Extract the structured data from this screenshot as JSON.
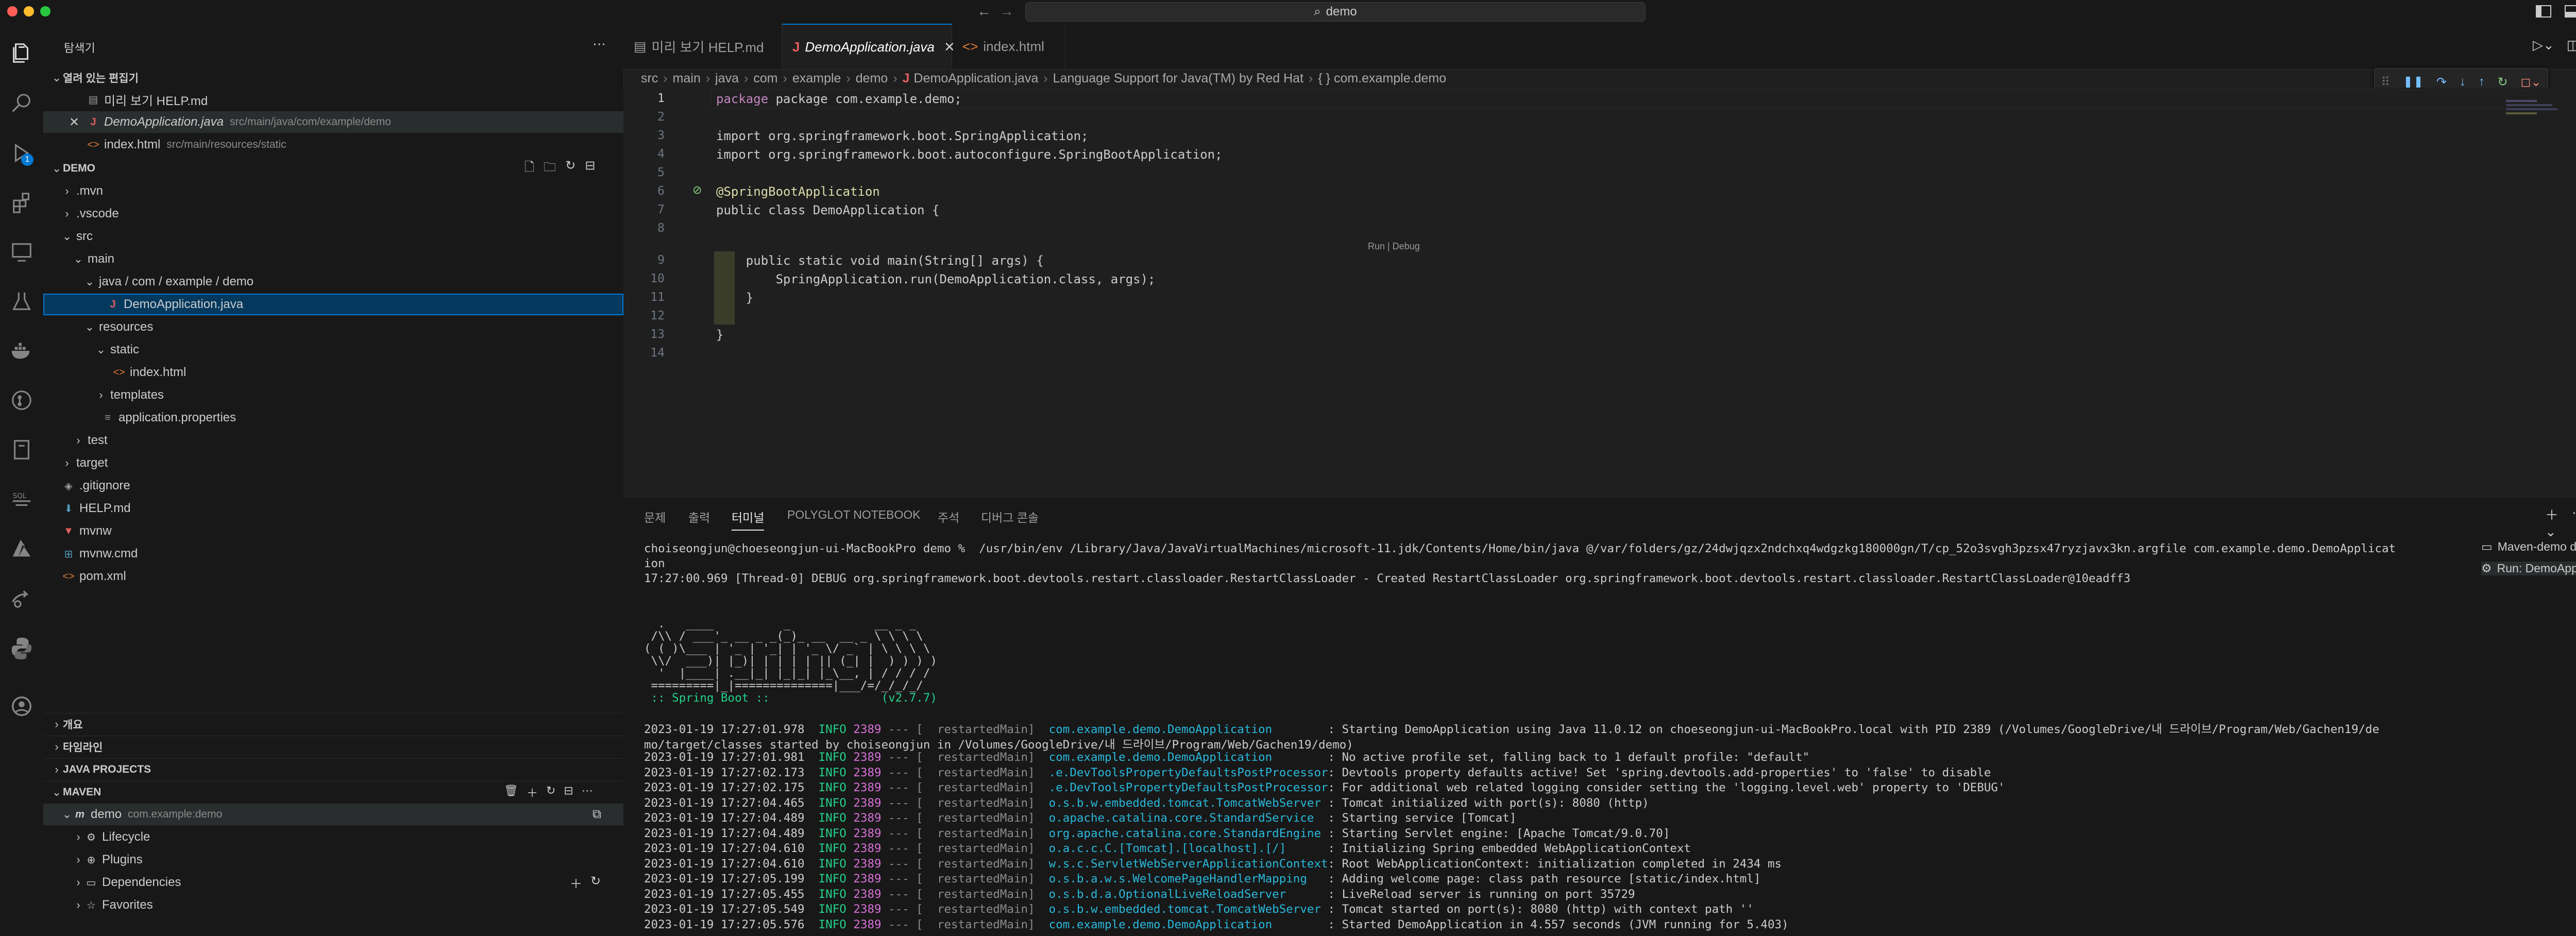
{
  "titlebar": {
    "search_text": "demo"
  },
  "activity": {
    "badge": "1"
  },
  "sidebar": {
    "header": "탐색기",
    "open_editors": {
      "title": "열려 있는 편집기",
      "items": [
        {
          "name": "미리 보기 HELP.md",
          "path": ""
        },
        {
          "name": "DemoApplication.java",
          "path": "src/main/java/com/example/demo"
        },
        {
          "name": "index.html",
          "path": "src/main/resources/static"
        }
      ]
    },
    "project": {
      "title": "DEMO",
      "tree": [
        ".mvn",
        ".vscode",
        "src",
        "main",
        "java / com / example / demo",
        "DemoApplication.java",
        "resources",
        "static",
        "index.html",
        "templates",
        "application.properties",
        "test",
        "target",
        ".gitignore",
        "HELP.md",
        "mvnw",
        "mvnw.cmd",
        "pom.xml"
      ]
    },
    "sections": [
      "개요",
      "타임라인",
      "JAVA PROJECTS",
      "MAVEN"
    ],
    "maven": {
      "project": "demo",
      "artifact": "com.example:demo",
      "children": [
        "Lifecycle",
        "Plugins",
        "Dependencies",
        "Favorites"
      ]
    }
  },
  "tabs": [
    "미리 보기 HELP.md",
    "DemoApplication.java",
    "index.html"
  ],
  "breadcrumb": [
    "src",
    "main",
    "java",
    "com",
    "example",
    "demo",
    "DemoApplication.java",
    "Language Support for Java(TM) by Red Hat",
    "{ } com.example.demo"
  ],
  "editor": {
    "codelens": "Run | Debug",
    "lines": [
      "1",
      "2",
      "3",
      "4",
      "5",
      "6",
      "7",
      "8",
      "9",
      "10",
      "11",
      "12",
      "13",
      "14"
    ],
    "code": {
      "l1": "package com.example.demo;",
      "l3": "import org.springframework.boot.SpringApplication;",
      "l4": "import org.springframework.boot.autoconfigure.SpringBootApplication;",
      "l6": "@SpringBootApplication",
      "l7": "public class DemoApplication {",
      "l9": "    public static void main(String[] args) {",
      "l10": "        SpringApplication.run(DemoApplication.class, args);",
      "l11": "    }",
      "l13": "}"
    }
  },
  "panel": {
    "tabs": [
      "문제",
      "출력",
      "터미널",
      "POLYGLOT NOTEBOOK",
      "주석",
      "디버그 콘솔"
    ],
    "terminals": [
      "Maven-demo d...",
      "Run: DemoAppli..."
    ],
    "terminal_lines": [
      "choiseongjun@choeseongjun-ui-MacBookPro demo %  /usr/bin/env /Library/Java/JavaVirtualMachines/microsoft-11.jdk/Contents/Home/bin/java @/var/folders/gz/24dwjqzx2ndchxq4wdgzkg180000gn/T/cp_52o3svgh3pzsx47ryzjavx3kn.argfile com.example.demo.DemoApplicat",
      "ion",
      "17:27:00.969 [Thread-0] DEBUG org.springframework.boot.devtools.restart.classloader.RestartClassLoader - Created RestartClassLoader org.springframework.boot.devtools.restart.classloader.RestartClassLoader@10eadff3"
    ],
    "banner": [
      "  .   ____          _            __ _ _",
      " /\\\\ / ___'_ __ _ _(_)_ __  __ _ \\ \\ \\ \\",
      "( ( )\\___ | '_ | '_| | '_ \\/ _` | \\ \\ \\ \\",
      " \\\\/  ___)| |_)| | | | | || (_| |  ) ) ) )",
      "  '  |____| .__|_| |_|_| |_\\__, | / / / /",
      " =========|_|==============|___/=/_/_/_/",
      " :: Spring Boot ::                (v2.7.7)"
    ],
    "logs": [
      [
        "2023-01-19 17:27:01.978",
        "INFO",
        "2389",
        "--- [  restartedMain] ",
        "com.example.demo.DemoApplication        ",
        ": Starting DemoApplication using Java 11.0.12 on choeseongjun-ui-MacBookPro.local with PID 2389 (/Volumes/GoogleDrive/내 드라이브/Program/Web/Gachen19/de"
      ],
      [
        "mo/target/classes started by choiseongjun in /Volumes/GoogleDrive/내 드라이브/Program/Web/Gachen19/demo)",
        "",
        "",
        "",
        "",
        ""
      ],
      [
        "2023-01-19 17:27:01.981",
        "INFO",
        "2389",
        "--- [  restartedMain] ",
        "com.example.demo.DemoApplication        ",
        ": No active profile set, falling back to 1 default profile: \"default\""
      ],
      [
        "2023-01-19 17:27:02.173",
        "INFO",
        "2389",
        "--- [  restartedMain] ",
        ".e.DevToolsPropertyDefaultsPostProcessor",
        ": Devtools property defaults active! Set 'spring.devtools.add-properties' to 'false' to disable"
      ],
      [
        "2023-01-19 17:27:02.175",
        "INFO",
        "2389",
        "--- [  restartedMain] ",
        ".e.DevToolsPropertyDefaultsPostProcessor",
        ": For additional web related logging consider setting the 'logging.level.web' property to 'DEBUG'"
      ],
      [
        "2023-01-19 17:27:04.465",
        "INFO",
        "2389",
        "--- [  restartedMain] ",
        "o.s.b.w.embedded.tomcat.TomcatWebServer ",
        ": Tomcat initialized with port(s): 8080 (http)"
      ],
      [
        "2023-01-19 17:27:04.489",
        "INFO",
        "2389",
        "--- [  restartedMain] ",
        "o.apache.catalina.core.StandardService  ",
        ": Starting service [Tomcat]"
      ],
      [
        "2023-01-19 17:27:04.489",
        "INFO",
        "2389",
        "--- [  restartedMain] ",
        "org.apache.catalina.core.StandardEngine ",
        ": Starting Servlet engine: [Apache Tomcat/9.0.70]"
      ],
      [
        "2023-01-19 17:27:04.610",
        "INFO",
        "2389",
        "--- [  restartedMain] ",
        "o.a.c.c.C.[Tomcat].[localhost].[/]      ",
        ": Initializing Spring embedded WebApplicationContext"
      ],
      [
        "2023-01-19 17:27:04.610",
        "INFO",
        "2389",
        "--- [  restartedMain] ",
        "w.s.c.ServletWebServerApplicationContext",
        ": Root WebApplicationContext: initialization completed in 2434 ms"
      ],
      [
        "2023-01-19 17:27:05.199",
        "INFO",
        "2389",
        "--- [  restartedMain] ",
        "o.s.b.a.w.s.WelcomePageHandlerMapping   ",
        ": Adding welcome page: class path resource [static/index.html]"
      ],
      [
        "2023-01-19 17:27:05.455",
        "INFO",
        "2389",
        "--- [  restartedMain] ",
        "o.s.b.d.a.OptionalLiveReloadServer      ",
        ": LiveReload server is running on port 35729"
      ],
      [
        "2023-01-19 17:27:05.549",
        "INFO",
        "2389",
        "--- [  restartedMain] ",
        "o.s.b.w.embedded.tomcat.TomcatWebServer ",
        ": Tomcat started on port(s): 8080 (http) with context path ''"
      ],
      [
        "2023-01-19 17:27:05.576",
        "INFO",
        "2389",
        "--- [  restartedMain] ",
        "com.example.demo.DemoApplication        ",
        ": Started DemoApplication in 4.557 seconds (JVM running for 5.403)"
      ]
    ]
  }
}
